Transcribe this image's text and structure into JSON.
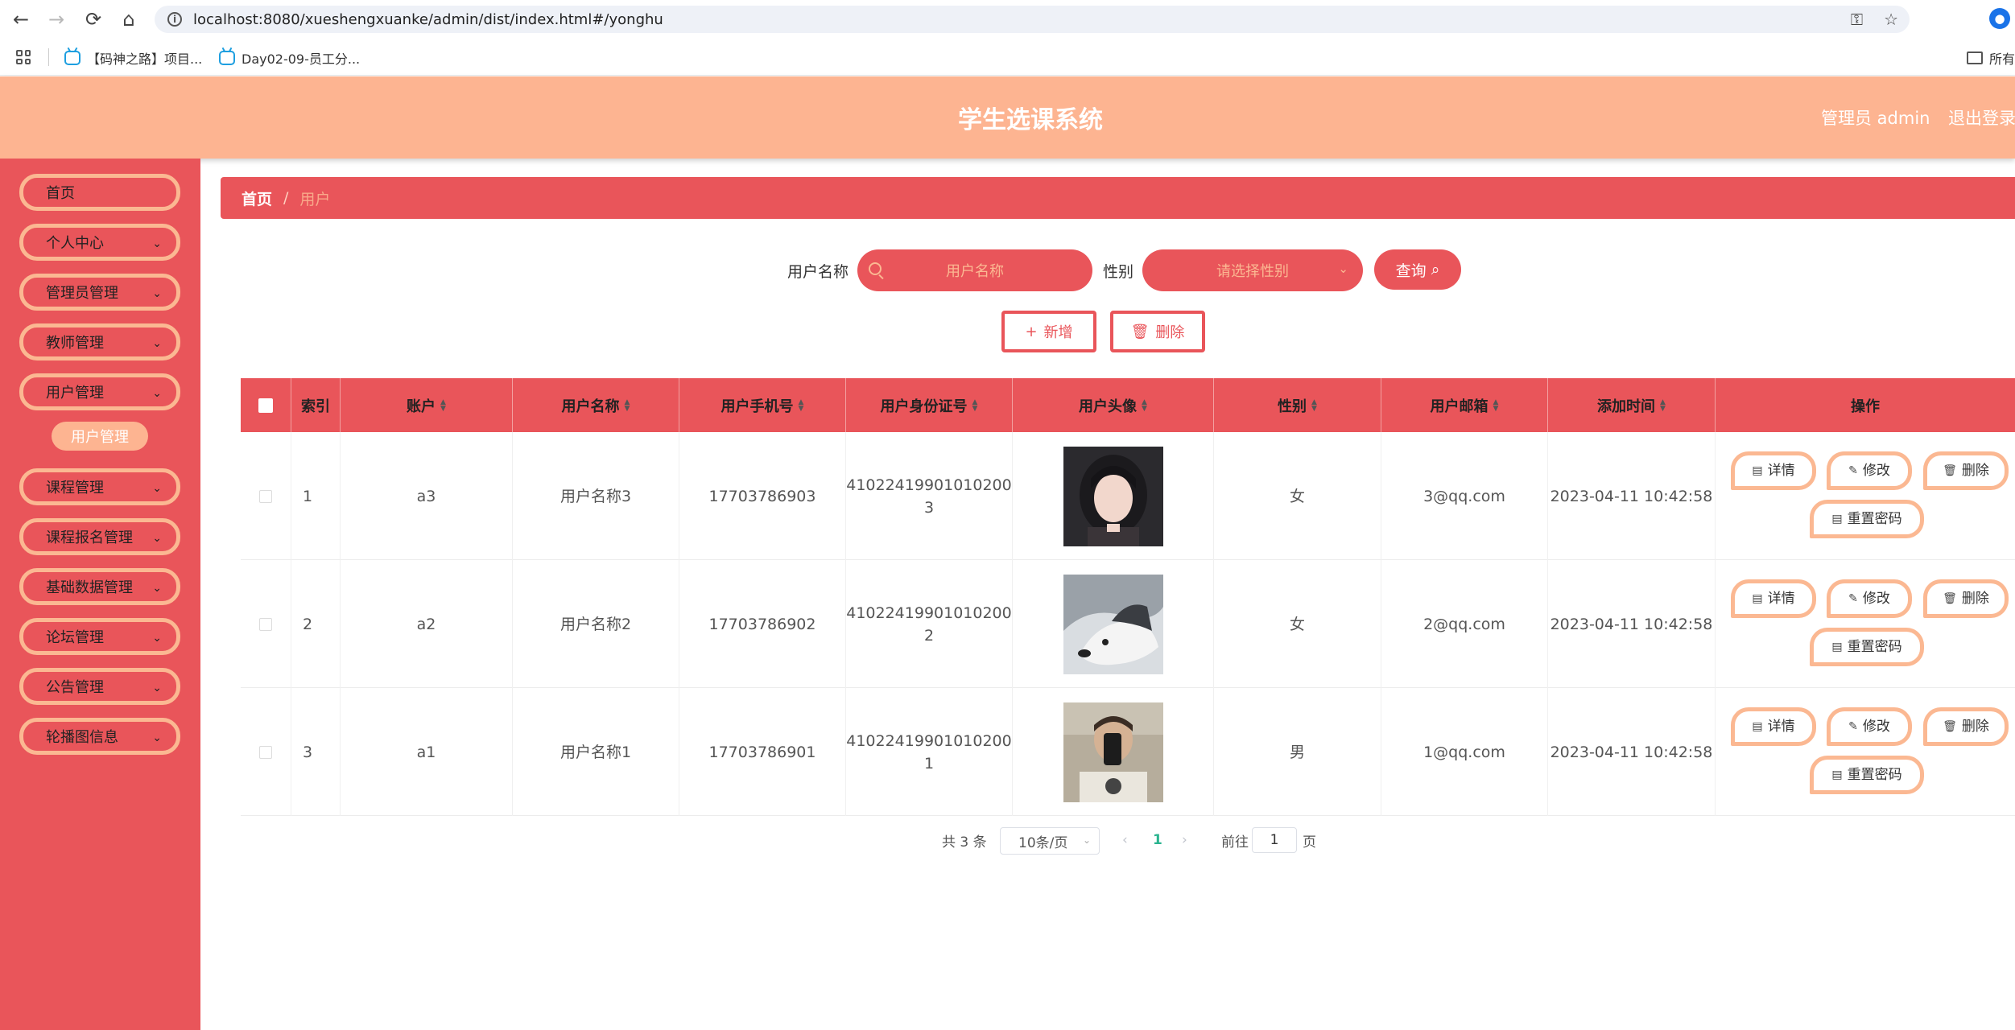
{
  "browser": {
    "url": "localhost:8080/xueshengxuanke/admin/dist/index.html#/yonghu",
    "bookmarks": [
      "【码神之路】项目...",
      "Day02-09-员工分..."
    ],
    "bookmark_folder": "所有"
  },
  "header": {
    "title": "学生选课系统",
    "user": "管理员 admin",
    "logout": "退出登录"
  },
  "sidebar": {
    "items": [
      {
        "label": "首页",
        "has_children": false
      },
      {
        "label": "个人中心",
        "has_children": true
      },
      {
        "label": "管理员管理",
        "has_children": true
      },
      {
        "label": "教师管理",
        "has_children": true
      },
      {
        "label": "用户管理",
        "has_children": true
      },
      {
        "label": "课程管理",
        "has_children": true
      },
      {
        "label": "课程报名管理",
        "has_children": true
      },
      {
        "label": "基础数据管理",
        "has_children": true
      },
      {
        "label": "论坛管理",
        "has_children": true
      },
      {
        "label": "公告管理",
        "has_children": true
      },
      {
        "label": "轮播图信息",
        "has_children": true
      }
    ],
    "active_submenu": "用户管理"
  },
  "breadcrumb": {
    "home": "首页",
    "separator": "/",
    "current": "用户"
  },
  "search": {
    "name_label": "用户名称",
    "name_placeholder": "用户名称",
    "gender_label": "性别",
    "gender_placeholder": "请选择性别",
    "query_button": "查询"
  },
  "actions": {
    "add": "新增",
    "delete": "删除"
  },
  "table": {
    "columns": [
      "索引",
      "账户",
      "用户名称",
      "用户手机号",
      "用户身份证号",
      "用户头像",
      "性别",
      "用户邮箱",
      "添加时间",
      "操作"
    ],
    "rows": [
      {
        "index": "1",
        "account": "a3",
        "name": "用户名称3",
        "phone": "17703786903",
        "id_card_line1": "41022419901010200",
        "id_card_line2": "3",
        "gender": "女",
        "email": "3@qq.com",
        "created": "2023-04-11 10:42:58"
      },
      {
        "index": "2",
        "account": "a2",
        "name": "用户名称2",
        "phone": "17703786902",
        "id_card_line1": "41022419901010200",
        "id_card_line2": "2",
        "gender": "女",
        "email": "2@qq.com",
        "created": "2023-04-11 10:42:58"
      },
      {
        "index": "3",
        "account": "a1",
        "name": "用户名称1",
        "phone": "17703786901",
        "id_card_line1": "41022419901010200",
        "id_card_line2": "1",
        "gender": "男",
        "email": "1@qq.com",
        "created": "2023-04-11 10:42:58"
      }
    ],
    "row_actions": {
      "detail": "详情",
      "edit": "修改",
      "delete": "删除",
      "reset": "重置密码"
    }
  },
  "pagination": {
    "total": "共 3 条",
    "page_size": "10条/页",
    "current_page": "1",
    "goto_label": "前往",
    "goto_value": "1",
    "page_suffix": "页"
  },
  "colors": {
    "primary": "#e9555a",
    "secondary": "#fdb491",
    "border_accent": "#fbb892"
  }
}
